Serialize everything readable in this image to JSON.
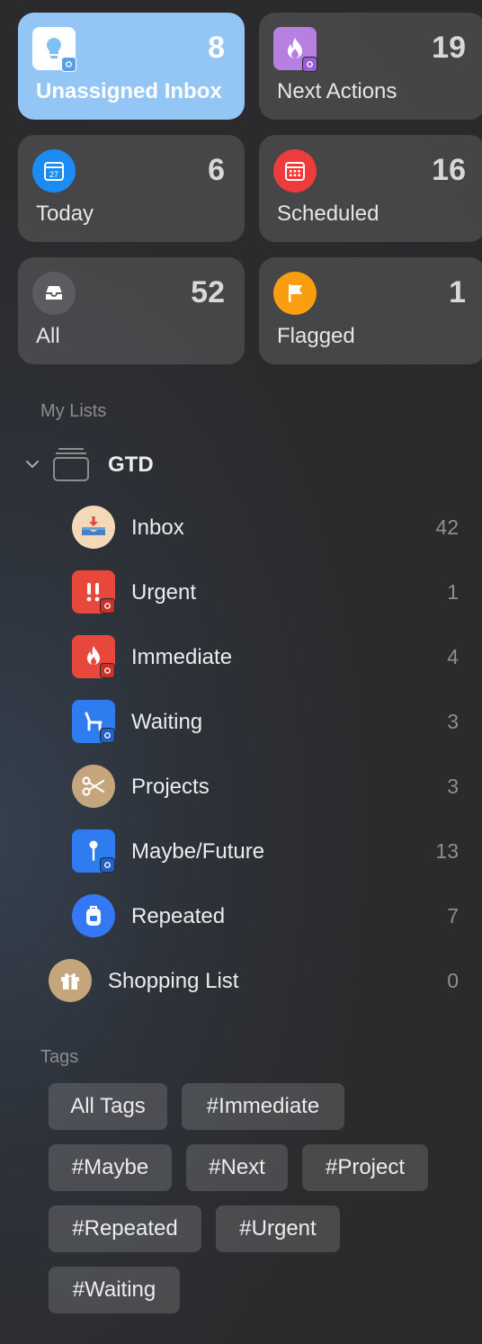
{
  "smart_lists": [
    {
      "label": "Unassigned Inbox",
      "count": "8",
      "icon": "lightbulb-icon",
      "color": "#ffffff"
    },
    {
      "label": "Next Actions",
      "count": "19",
      "icon": "flame-icon",
      "color": "#b77fe0"
    },
    {
      "label": "Today",
      "count": "6",
      "icon": "calendar-icon",
      "color": "#1c8cf5"
    },
    {
      "label": "Scheduled",
      "count": "16",
      "icon": "calendar-grid-icon",
      "color": "#ef3b3b"
    },
    {
      "label": "All",
      "count": "52",
      "icon": "tray-icon",
      "color": "#5c5c60"
    },
    {
      "label": "Flagged",
      "count": "1",
      "icon": "flag-icon",
      "color": "#f99e0f"
    }
  ],
  "my_lists": {
    "header": "My Lists",
    "group": {
      "name": "GTD",
      "icon": "folder-stack-icon"
    },
    "lists": [
      {
        "name": "Inbox",
        "count": "42",
        "icon": "inbox-tray-icon",
        "color": "#f3d9b8"
      },
      {
        "name": "Urgent",
        "count": "1",
        "icon": "exclamation-icon",
        "color": "#e8473c"
      },
      {
        "name": "Immediate",
        "count": "4",
        "icon": "fire-icon",
        "color": "#e8473c"
      },
      {
        "name": "Waiting",
        "count": "3",
        "icon": "bench-icon",
        "color": "#2f7bf0"
      },
      {
        "name": "Projects",
        "count": "3",
        "icon": "scissors-icon",
        "color": "#c4a57c"
      },
      {
        "name": "Maybe/Future",
        "count": "13",
        "icon": "pin-icon",
        "color": "#2f7bf0"
      },
      {
        "name": "Repeated",
        "count": "7",
        "icon": "backpack-icon",
        "color": "#3478f6"
      }
    ],
    "shopping": {
      "name": "Shopping List",
      "count": "0",
      "icon": "gift-icon",
      "color": "#c4a57c"
    }
  },
  "tags": {
    "header": "Tags",
    "items": [
      "All Tags",
      "#Immediate",
      "#Maybe",
      "#Next",
      "#Project",
      "#Repeated",
      "#Urgent",
      "#Waiting"
    ]
  }
}
